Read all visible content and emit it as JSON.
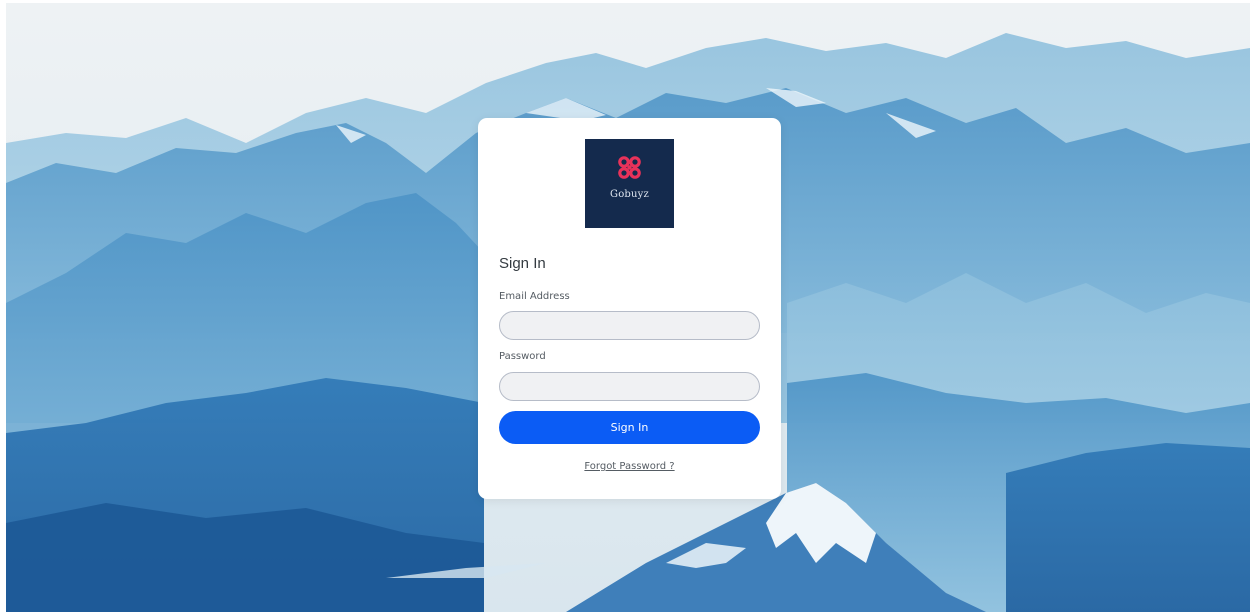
{
  "brand": {
    "name": "Gobuyz",
    "logo_bg": "#142a4d",
    "logo_accent": "#e8325a"
  },
  "form": {
    "title": "Sign In",
    "email_label": "Email Address",
    "email_value": "",
    "email_placeholder": "",
    "password_label": "Password",
    "password_value": "",
    "password_placeholder": "",
    "submit_label": "Sign In",
    "forgot_label": "Forgot Password ?"
  },
  "theme": {
    "button_color": "#0b5cf5",
    "input_bg": "#f0f1f3",
    "input_border": "#b6bcc8"
  }
}
